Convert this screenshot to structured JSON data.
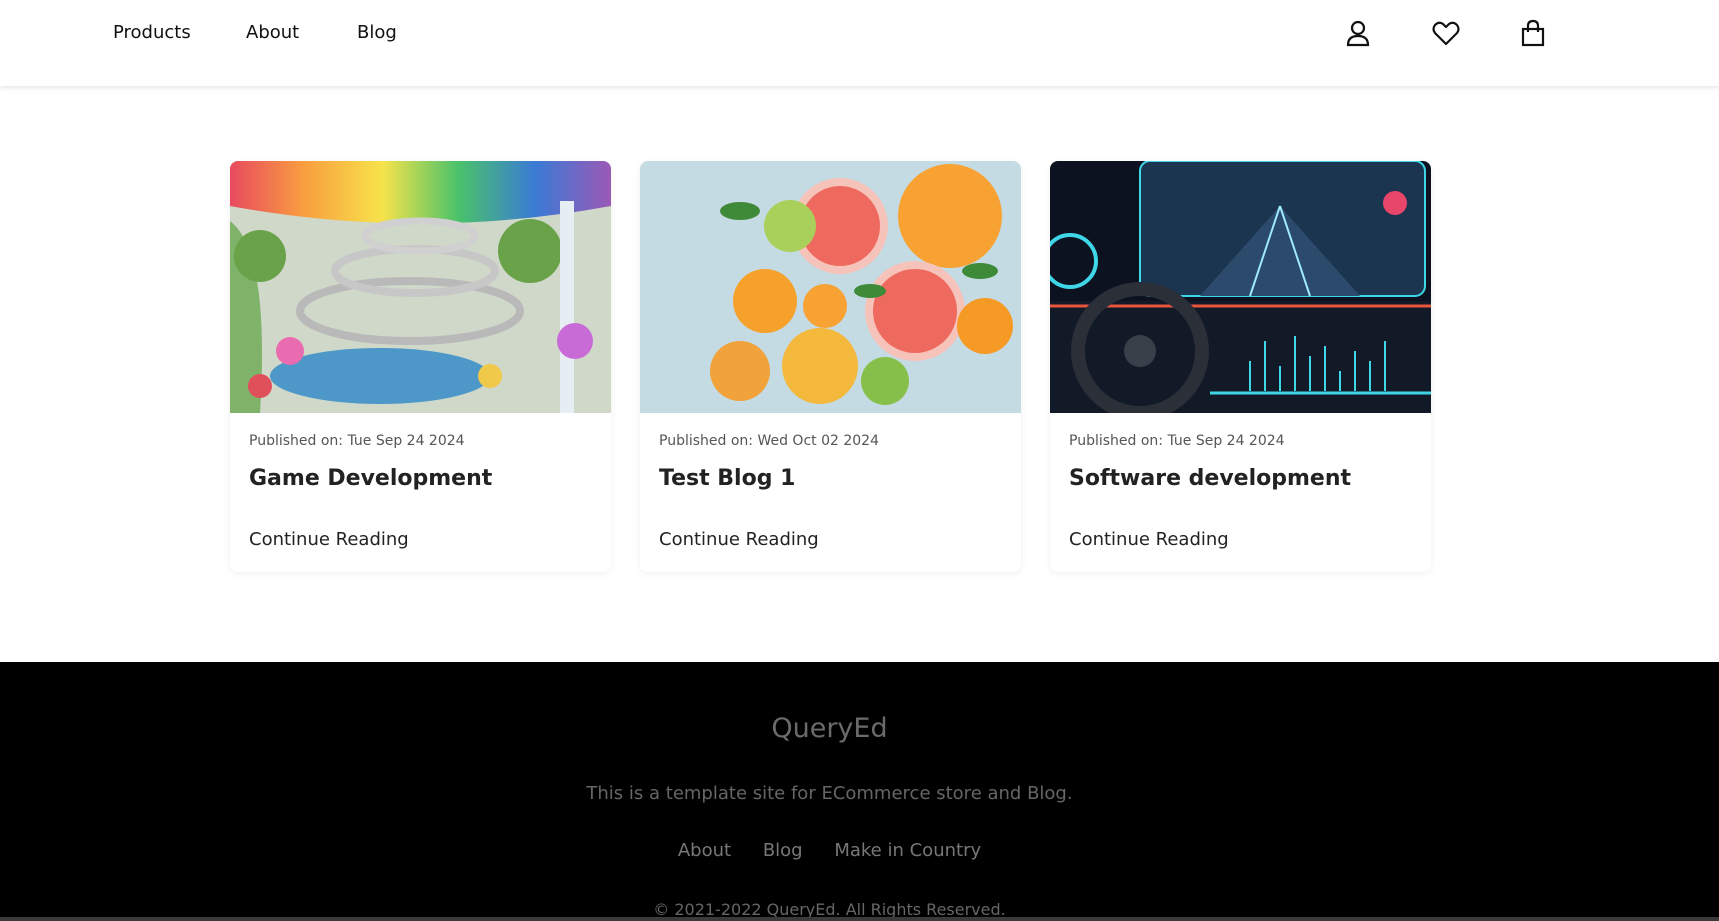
{
  "nav": {
    "links": [
      "Products",
      "About",
      "Blog"
    ],
    "icons": [
      "user-icon",
      "heart-icon",
      "bag-icon"
    ]
  },
  "posts": [
    {
      "date": "Published on: Tue Sep 24 2024",
      "title": "Game Development",
      "link": "Continue Reading",
      "image": "staircase-garden-image"
    },
    {
      "date": "Published on: Wed Oct 02 2024",
      "title": "Test Blog 1",
      "link": "Continue Reading",
      "image": "citrus-fruits-image"
    },
    {
      "date": "Published on: Tue Sep 24 2024",
      "title": "Software development",
      "link": "Continue Reading",
      "image": "car-dashboard-image"
    }
  ],
  "footer": {
    "brand": "QueryEd",
    "description": "This is a template site for ECommerce store and Blog.",
    "links": [
      "About",
      "Blog",
      "Make in Country"
    ],
    "copyright": "© 2021-2022 QueryEd. All Rights Reserved."
  },
  "colors": {
    "footer_bg": "#000000",
    "footer_text": "#666666",
    "accent_cyan": "#3fd6e8"
  }
}
